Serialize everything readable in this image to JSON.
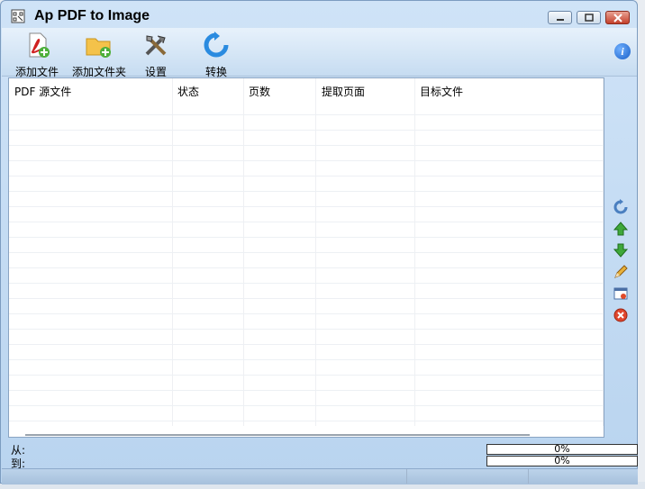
{
  "window": {
    "title": "Ap PDF to Image"
  },
  "toolbar": {
    "add_file": "添加文件",
    "add_folder": "添加文件夹",
    "settings": "设置",
    "convert": "转换"
  },
  "table": {
    "columns": [
      "PDF 源文件",
      "状态",
      "页数",
      "提取页面",
      "目标文件"
    ]
  },
  "bottom": {
    "from_label": "从:",
    "to_label": "到:",
    "progress1": "0%",
    "progress2": "0%"
  },
  "colors": {
    "accent": "#1a5fc7",
    "window_bg": "#cfe3f7"
  }
}
